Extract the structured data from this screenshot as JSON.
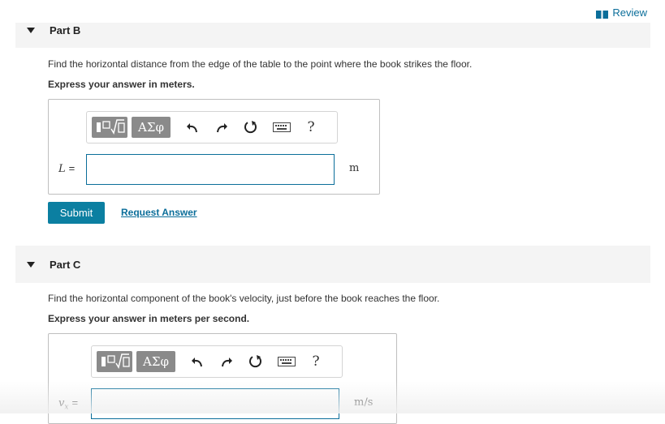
{
  "header": {
    "review_label": "Review"
  },
  "part_b": {
    "title": "Part B",
    "prompt": "Find the horizontal distance from the edge of the table to the point where the book strikes the floor.",
    "instruction": "Express your answer in meters.",
    "toolbar": {
      "greek_label": "ΑΣφ",
      "help_label": "?"
    },
    "variable": "L",
    "equals": "=",
    "input_value": "",
    "unit": "m",
    "submit_label": "Submit",
    "request_answer_label": "Request Answer"
  },
  "part_c": {
    "title": "Part C",
    "prompt": "Find the horizontal component of the book's velocity, just before the book reaches the floor.",
    "instruction": "Express your answer in meters per second.",
    "toolbar": {
      "greek_label": "ΑΣφ",
      "help_label": "?"
    },
    "variable": "v",
    "variable_sub": "x",
    "equals": "=",
    "input_value": "",
    "unit": "m/s"
  },
  "icons": [
    "book-icon",
    "caret-down-icon",
    "template-icon",
    "undo-icon",
    "redo-icon",
    "reset-icon",
    "keyboard-icon",
    "help-icon"
  ],
  "colors": {
    "link": "#0b6e9a",
    "submit_bg": "#0b7fa1",
    "toolbar_btn": "#8a8a8a",
    "part_bar": "#f4f4f4"
  }
}
